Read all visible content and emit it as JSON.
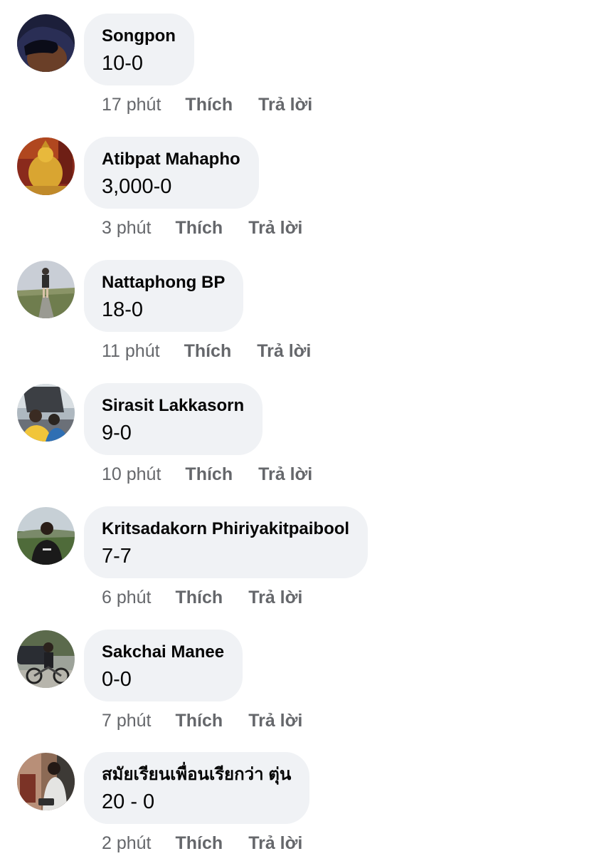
{
  "comments": [
    {
      "author": "Songpon",
      "text": "10-0",
      "time": "17 phút",
      "like": "Thích",
      "reply": "Trả lời"
    },
    {
      "author": "Atibpat Mahapho",
      "text": "3,000-0",
      "time": "3 phút",
      "like": "Thích",
      "reply": "Trả lời"
    },
    {
      "author": "Nattaphong BP",
      "text": "18-0",
      "time": "11 phút",
      "like": "Thích",
      "reply": "Trả lời"
    },
    {
      "author": "Sirasit Lakkasorn",
      "text": "9-0",
      "time": "10 phút",
      "like": "Thích",
      "reply": "Trả lời"
    },
    {
      "author": "Kritsadakorn Phiriyakitpaibool",
      "text": "7-7",
      "time": "6 phút",
      "like": "Thích",
      "reply": "Trả lời"
    },
    {
      "author": "Sakchai Manee",
      "text": "0-0",
      "time": "7 phút",
      "like": "Thích",
      "reply": "Trả lời"
    },
    {
      "author": "สมัยเรียนเพื่อนเรียกว่า ตุ่น",
      "text": "20 - 0",
      "time": "2 phút",
      "like": "Thích",
      "reply": "Trả lời"
    }
  ],
  "colors": {
    "bubble_background": "#f0f2f5",
    "meta_text": "#65676b",
    "primary_text": "#050505"
  }
}
